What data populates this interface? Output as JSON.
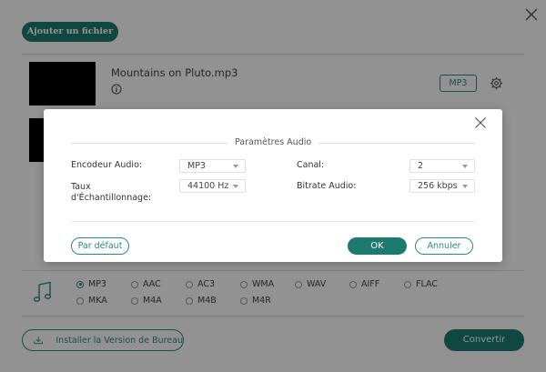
{
  "colors": {
    "accent": "#1d7a6f",
    "overlay": "rgba(0,0,0,0.42)"
  },
  "header": {
    "add_file_label": "Ajouter un fichier",
    "close_icon": "close-icon"
  },
  "file": {
    "name": "Mountains on Pluto.mp3",
    "format_badge": "MP3",
    "info_icon": "info-icon",
    "settings_icon": "gear-icon"
  },
  "dialog": {
    "title": "Paramètres Audio",
    "encoder": {
      "label": "Encodeur Audio:",
      "value": "MP3"
    },
    "samplerate": {
      "label_line1": "Taux",
      "label_line2": "d'Échantillonnage:",
      "value": "44100 Hz"
    },
    "channel": {
      "label": "Canal:",
      "value": "2"
    },
    "bitrate": {
      "label": "Bitrate Audio:",
      "value": "256 kbps"
    },
    "default_label": "Par défaut",
    "ok_label": "OK",
    "cancel_label": "Annuler"
  },
  "formats": {
    "selected": "MP3",
    "row1": [
      "MP3",
      "AAC",
      "AC3",
      "WMA",
      "WAV",
      "AIFF",
      "FLAC"
    ],
    "row2": [
      "MKA",
      "M4A",
      "M4B",
      "M4R"
    ]
  },
  "footer": {
    "install_label": "Installer la Version de Bureau",
    "convert_label": "Convertir"
  }
}
